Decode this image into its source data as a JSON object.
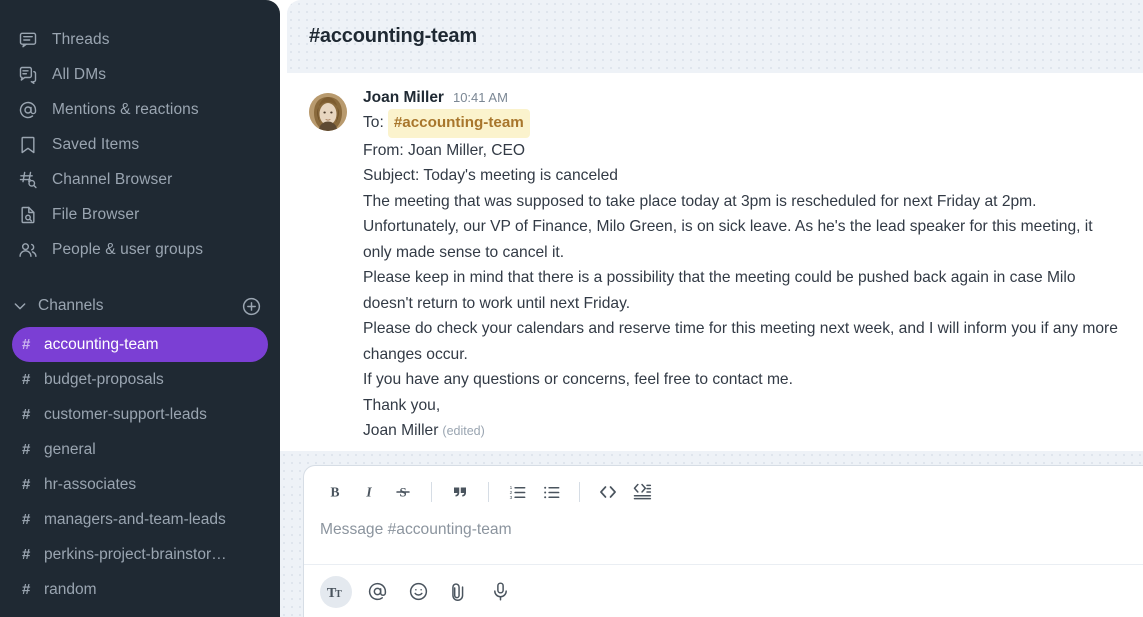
{
  "sidebar": {
    "nav": [
      {
        "label": "Threads",
        "icon": "threads-icon"
      },
      {
        "label": "All DMs",
        "icon": "all-dms-icon"
      },
      {
        "label": "Mentions & reactions",
        "icon": "mentions-icon"
      },
      {
        "label": "Saved Items",
        "icon": "bookmark-icon"
      },
      {
        "label": "Channel Browser",
        "icon": "channel-browser-icon"
      },
      {
        "label": "File Browser",
        "icon": "file-browser-icon"
      },
      {
        "label": "People & user groups",
        "icon": "people-icon"
      }
    ],
    "channels_section": {
      "title": "Channels",
      "caret_icon": "chevron-down-icon",
      "add_icon": "plus-circle-icon"
    },
    "channels": [
      {
        "name": "accounting-team",
        "hash": "#",
        "active": true
      },
      {
        "name": "budget-proposals",
        "hash": "#",
        "active": false
      },
      {
        "name": "customer-support-leads",
        "hash": "#",
        "active": false
      },
      {
        "name": "general",
        "hash": "#",
        "active": false
      },
      {
        "name": "hr-associates",
        "hash": "#",
        "active": false
      },
      {
        "name": "managers-and-team-leads",
        "hash": "#",
        "active": false
      },
      {
        "name": "perkins-project-brainstor…",
        "hash": "#",
        "active": false
      },
      {
        "name": "random",
        "hash": "#",
        "active": false
      }
    ],
    "active_color": "#7b3fd4",
    "background_color": "#1f2933"
  },
  "header": {
    "channel_title": "#accounting-team"
  },
  "message": {
    "author": "Joan Miller",
    "time": "10:41 AM",
    "avatar_icon": "user-avatar",
    "to_label": "To:",
    "to_chip": "#accounting-team",
    "lines": [
      "From: Joan Miller, CEO",
      "Subject: Today's meeting is canceled",
      "The meeting that was supposed to take place today at 3pm is rescheduled for next Friday at 2pm.",
      "Unfortunately, our VP of Finance, Milo Green, is on sick leave. As he's the lead speaker for this meeting, it only made sense to cancel it.",
      "Please keep in mind that there is a possibility that the meeting could be pushed back again in case Milo doesn't return to work until next Friday.",
      "Please do check your calendars and reserve time for this meeting next week, and I will inform you if any more changes occur.",
      "If you have any questions or concerns, feel free to contact me.",
      "Thank you,"
    ],
    "signature": "Joan Miller",
    "edited_label": "(edited)"
  },
  "composer": {
    "placeholder": "Message #accounting-team",
    "format_buttons": [
      {
        "name": "bold-button",
        "icon": "bold-icon",
        "label": "B"
      },
      {
        "name": "italic-button",
        "icon": "italic-icon",
        "label": "I"
      },
      {
        "name": "strikethrough-button",
        "icon": "strikethrough-icon",
        "label": "S"
      },
      {
        "name": "blockquote-button",
        "icon": "quote-icon",
        "label": "””"
      },
      {
        "name": "ordered-list-button",
        "icon": "ordered-list-icon",
        "label": "1."
      },
      {
        "name": "bulleted-list-button",
        "icon": "bulleted-list-icon",
        "label": "•"
      },
      {
        "name": "code-button",
        "icon": "code-icon",
        "label": "<>"
      },
      {
        "name": "code-block-button",
        "icon": "code-block-icon",
        "label": "<>≡"
      }
    ],
    "action_buttons": [
      {
        "name": "text-formatting-button",
        "icon": "text-format-icon",
        "active": true
      },
      {
        "name": "mention-button",
        "icon": "at-icon",
        "active": false
      },
      {
        "name": "emoji-button",
        "icon": "smiley-icon",
        "active": false
      },
      {
        "name": "attachment-button",
        "icon": "paperclip-icon",
        "active": false
      },
      {
        "name": "microphone-button",
        "icon": "microphone-icon",
        "active": false
      }
    ]
  }
}
